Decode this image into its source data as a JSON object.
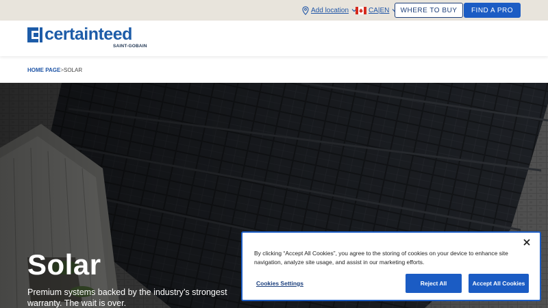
{
  "utility_bar": {
    "location_label": "Add location",
    "lang_label": "CA|EN",
    "where_to_buy": "WHERE TO BUY",
    "find_a_pro": "FIND A PRO"
  },
  "header": {
    "logo_text": "certainteed",
    "logo_sub": "SAINT-GOBAIN"
  },
  "breadcrumb": {
    "home": "HOME PAGE",
    "separator": ">",
    "current": "SOLAR"
  },
  "hero": {
    "title": "Solar",
    "subtitle": "Premium systems backed by the industry’s strongest warranty. The wait is over."
  },
  "cookie_banner": {
    "text": "By clicking “Accept All Cookies”, you agree to the storing of cookies on your device to enhance site navigation, analyze site usage, and assist in our marketing efforts.",
    "settings": "Cookies Settings",
    "reject": "Reject All",
    "accept": "Accept All Cookies"
  },
  "colors": {
    "brand_blue": "#1b5cc4",
    "navy": "#1d3f7a",
    "utility_bg": "#e8e4dc"
  }
}
